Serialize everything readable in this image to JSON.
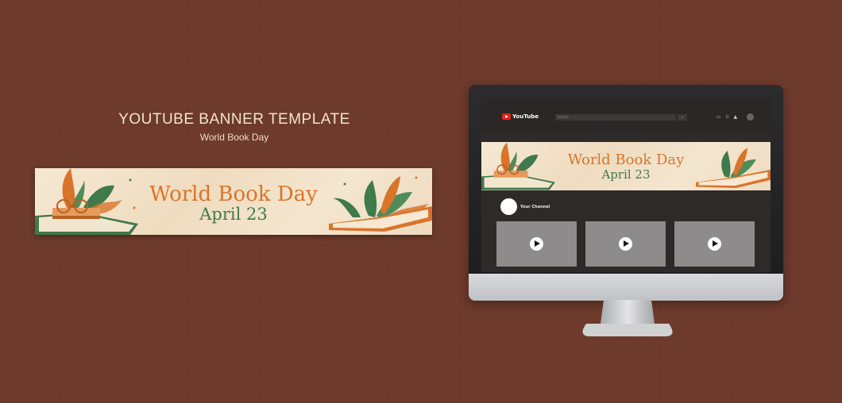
{
  "heading": {
    "title": "YOUTUBE BANNER TEMPLATE",
    "subtitle": "World Book Day"
  },
  "banner": {
    "title": "World Book Day",
    "date": "April 23"
  },
  "youtube": {
    "logo_text": "YouTube",
    "search_placeholder": "Search",
    "search_icon": "⌕",
    "icons": [
      "video-icon",
      "apps-icon",
      "bell-icon"
    ],
    "channel_name": "Your Channel",
    "videos": [
      {
        "play_icon": "play-icon"
      },
      {
        "play_icon": "play-icon"
      },
      {
        "play_icon": "play-icon"
      }
    ]
  },
  "colors": {
    "background": "#6e3a2c",
    "banner_title": "#d8752a",
    "banner_date": "#3f7a4c",
    "youtube_red": "#e62117"
  }
}
